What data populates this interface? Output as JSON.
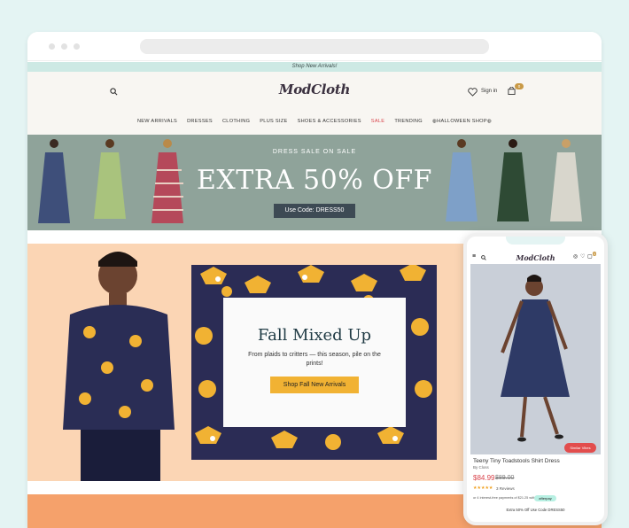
{
  "promo_bar": {
    "text": "Shop New Arrivals!"
  },
  "header": {
    "logo": "ModCloth",
    "sign_in": "Sign in",
    "cart_count": "0"
  },
  "nav": {
    "items": [
      {
        "label": "NEW ARRIVALS"
      },
      {
        "label": "DRESSES"
      },
      {
        "label": "CLOTHING"
      },
      {
        "label": "PLUS SIZE"
      },
      {
        "label": "SHOES & ACCESSORIES"
      },
      {
        "label": "SALE"
      },
      {
        "label": "TRENDING"
      },
      {
        "label": "HALLOWEEN SHOP"
      }
    ]
  },
  "banner": {
    "kicker": "DRESS SALE ON SALE",
    "headline": "EXTRA 50% OFF",
    "code": "Use Code: DRESS50"
  },
  "feature": {
    "title": "Fall Mixed Up",
    "subtitle": "From plaids to critters — this season, pile on the prints!",
    "cta": "Shop Fall New Arrivals"
  },
  "mobile": {
    "logo": "ModCloth",
    "cart_count": "0",
    "similar_label": "Similar Vibes",
    "product_name": "Teeny Tiny Toadstools Shirt Dress",
    "brand": "By Closs",
    "price": "$84.99",
    "old_price": "$89.00",
    "stars": "★★★★★",
    "reviews": "3 Reviews",
    "payments": "or 4 interest-free payments of $21.25 with",
    "afterpay": "afterpay",
    "promo": "Extra 50% Off Use Code DRESS50"
  },
  "colors": {
    "banner_bg": "#8fa39a",
    "feature_bg": "#fbd5b4",
    "cta_bg": "#f1b233",
    "sale_red": "#d9434b",
    "promo_bg": "#cde9e4"
  }
}
